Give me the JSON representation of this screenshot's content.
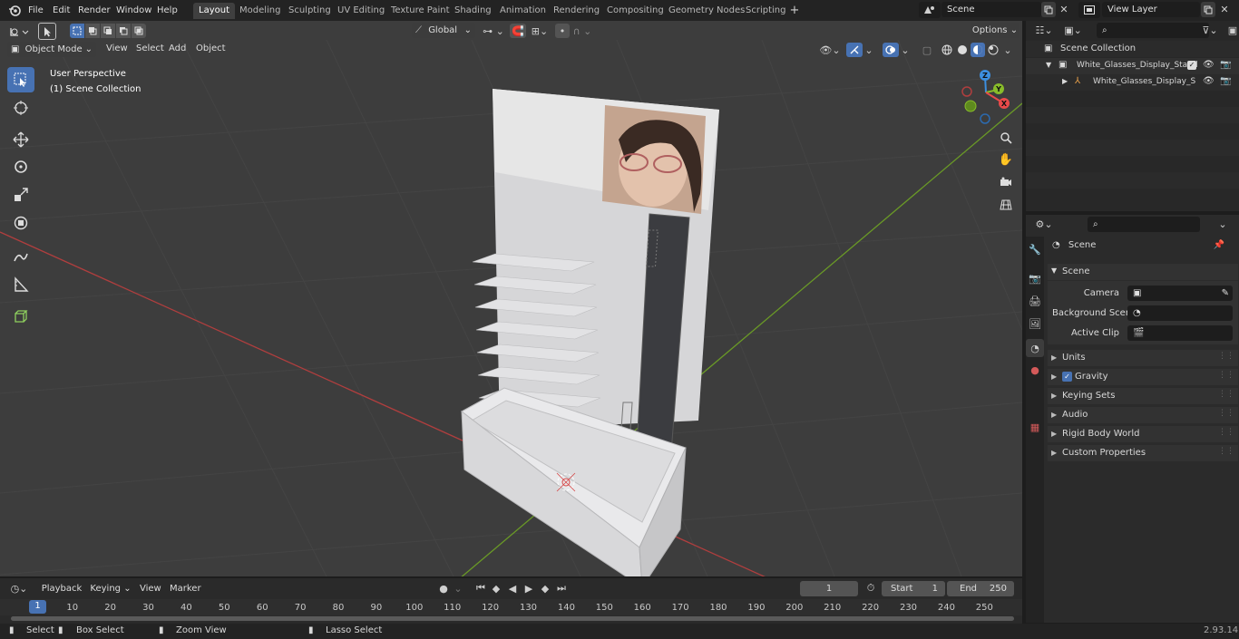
{
  "menu": {
    "file": "File",
    "edit": "Edit",
    "render": "Render",
    "window": "Window",
    "help": "Help"
  },
  "workspaces": [
    "Layout",
    "Modeling",
    "Sculpting",
    "UV Editing",
    "Texture Paint",
    "Shading",
    "Animation",
    "Rendering",
    "Compositing",
    "Geometry Nodes",
    "Scripting"
  ],
  "active_workspace": "Layout",
  "scene_field": "Scene",
  "view_layer_field": "View Layer",
  "viewport_header": {
    "mode": "Object Mode",
    "view": "View",
    "select": "Select",
    "add": "Add",
    "object": "Object",
    "transform_orientation": "Global",
    "options": "Options"
  },
  "viewport_overlay": {
    "perspective": "User Perspective",
    "collection": "(1) Scene Collection"
  },
  "gizmo": {
    "z": "Z",
    "y": "Y",
    "x": "X"
  },
  "outliner": {
    "root": "Scene Collection",
    "item1": "White_Glasses_Display_Stand",
    "item2": "White_Glasses_Display_S"
  },
  "properties": {
    "header": "Scene",
    "section": "Scene",
    "camera_label": "Camera",
    "background_scene_label": "Background Scene",
    "active_clip_label": "Active Clip",
    "panels": [
      "Units",
      "Gravity",
      "Keying Sets",
      "Audio",
      "Rigid Body World",
      "Custom Properties"
    ],
    "gravity_checked": true
  },
  "timeline": {
    "playback": "Playback",
    "keying": "Keying",
    "view": "View",
    "marker": "Marker",
    "current_frame": "1",
    "start_label": "Start",
    "start": "1",
    "end_label": "End",
    "end": "250",
    "ticks": [
      "1",
      "10",
      "20",
      "30",
      "40",
      "50",
      "60",
      "70",
      "80",
      "90",
      "100",
      "110",
      "120",
      "130",
      "140",
      "150",
      "160",
      "170",
      "180",
      "190",
      "200",
      "210",
      "220",
      "230",
      "240",
      "250"
    ]
  },
  "status": {
    "select": "Select",
    "box_select": "Box Select",
    "zoom_view": "Zoom View",
    "lasso_select": "Lasso Select",
    "version": "2.93.14"
  },
  "colors": {
    "accent": "#4772b3",
    "x_axis": "#e94a4a",
    "y_axis": "#88bc2a",
    "z_axis": "#3c8fe0"
  }
}
